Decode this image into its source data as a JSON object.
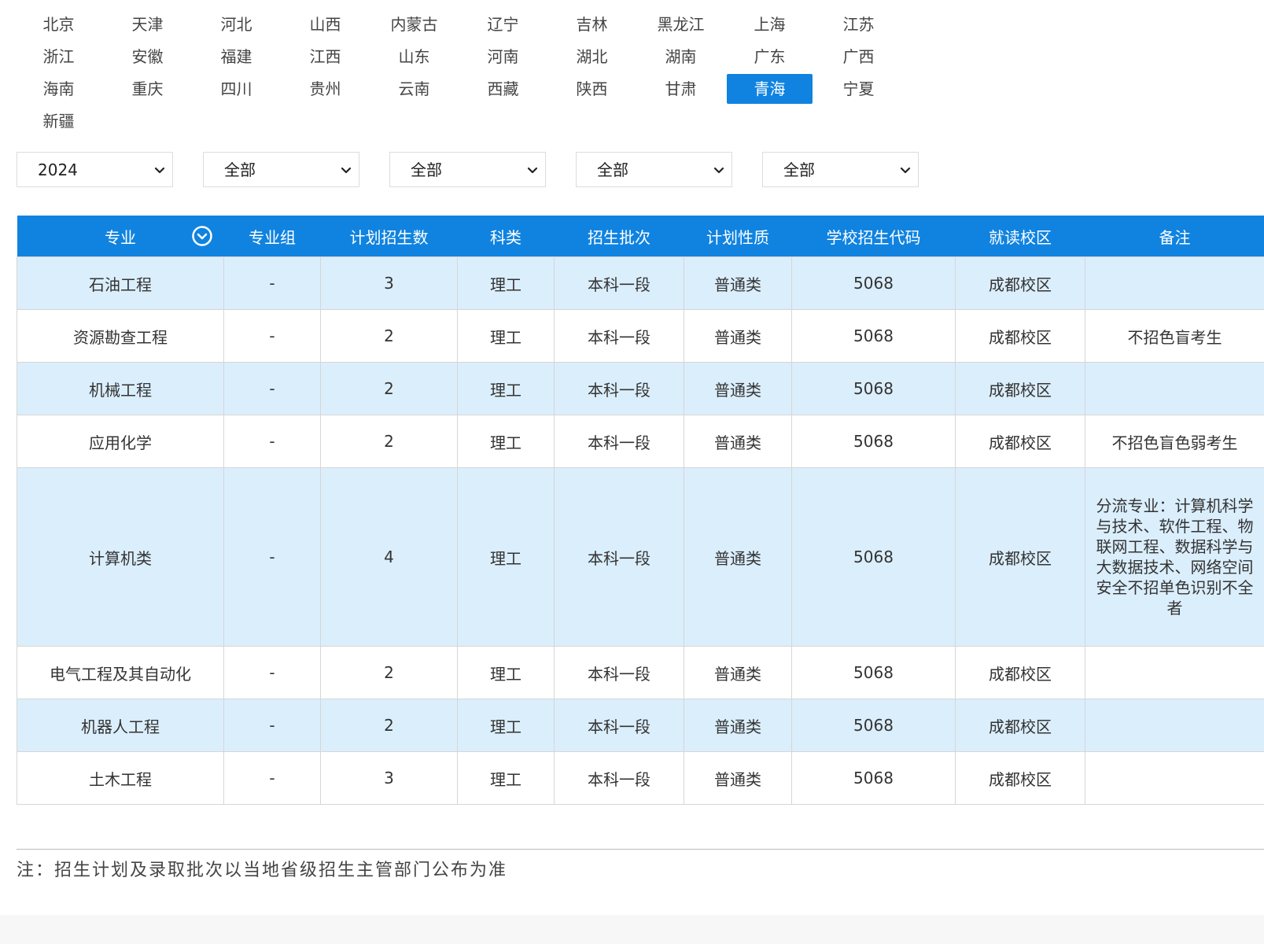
{
  "provinces": [
    "北京",
    "天津",
    "河北",
    "山西",
    "内蒙古",
    "辽宁",
    "吉林",
    "黑龙江",
    "上海",
    "江苏",
    "浙江",
    "安徽",
    "福建",
    "江西",
    "山东",
    "河南",
    "湖北",
    "湖南",
    "广东",
    "广西",
    "海南",
    "重庆",
    "四川",
    "贵州",
    "云南",
    "西藏",
    "陕西",
    "甘肃",
    "青海",
    "宁夏",
    "新疆"
  ],
  "active_province": "青海",
  "filters": [
    {
      "value": "2024",
      "icon": "chevron-down-icon"
    },
    {
      "value": "全部",
      "icon": "chevron-down-icon"
    },
    {
      "value": "全部",
      "icon": "chevron-down-icon"
    },
    {
      "value": "全部",
      "icon": "chevron-down-icon"
    },
    {
      "value": "全部",
      "icon": "chevron-down-icon"
    }
  ],
  "table": {
    "headers": [
      "专业",
      "专业组",
      "计划招生数",
      "科类",
      "招生批次",
      "计划性质",
      "学校招生代码",
      "就读校区",
      "备注"
    ],
    "sort_icon": "circle-chevron-down-icon",
    "rows": [
      {
        "major": "石油工程",
        "group": "-",
        "count": "3",
        "subject": "理工",
        "batch": "本科一段",
        "type": "普通类",
        "code": "5068",
        "campus": "成都校区",
        "note": ""
      },
      {
        "major": "资源勘查工程",
        "group": "-",
        "count": "2",
        "subject": "理工",
        "batch": "本科一段",
        "type": "普通类",
        "code": "5068",
        "campus": "成都校区",
        "note": "不招色盲考生"
      },
      {
        "major": "机械工程",
        "group": "-",
        "count": "2",
        "subject": "理工",
        "batch": "本科一段",
        "type": "普通类",
        "code": "5068",
        "campus": "成都校区",
        "note": ""
      },
      {
        "major": "应用化学",
        "group": "-",
        "count": "2",
        "subject": "理工",
        "batch": "本科一段",
        "type": "普通类",
        "code": "5068",
        "campus": "成都校区",
        "note": "不招色盲色弱考生"
      },
      {
        "major": "计算机类",
        "group": "-",
        "count": "4",
        "subject": "理工",
        "batch": "本科一段",
        "type": "普通类",
        "code": "5068",
        "campus": "成都校区",
        "note": "分流专业：计算机科学与技术、软件工程、物联网工程、数据科学与大数据技术、网络空间安全不招单色识别不全者"
      },
      {
        "major": "电气工程及其自动化",
        "group": "-",
        "count": "2",
        "subject": "理工",
        "batch": "本科一段",
        "type": "普通类",
        "code": "5068",
        "campus": "成都校区",
        "note": ""
      },
      {
        "major": "机器人工程",
        "group": "-",
        "count": "2",
        "subject": "理工",
        "batch": "本科一段",
        "type": "普通类",
        "code": "5068",
        "campus": "成都校区",
        "note": ""
      },
      {
        "major": "土木工程",
        "group": "-",
        "count": "3",
        "subject": "理工",
        "batch": "本科一段",
        "type": "普通类",
        "code": "5068",
        "campus": "成都校区",
        "note": ""
      }
    ]
  },
  "footnote": "注：招生计划及录取批次以当地省级招生主管部门公布为准",
  "colors": {
    "accent": "#1083e0",
    "row_highlight": "#dbeefc",
    "border": "#d6d6d6"
  }
}
